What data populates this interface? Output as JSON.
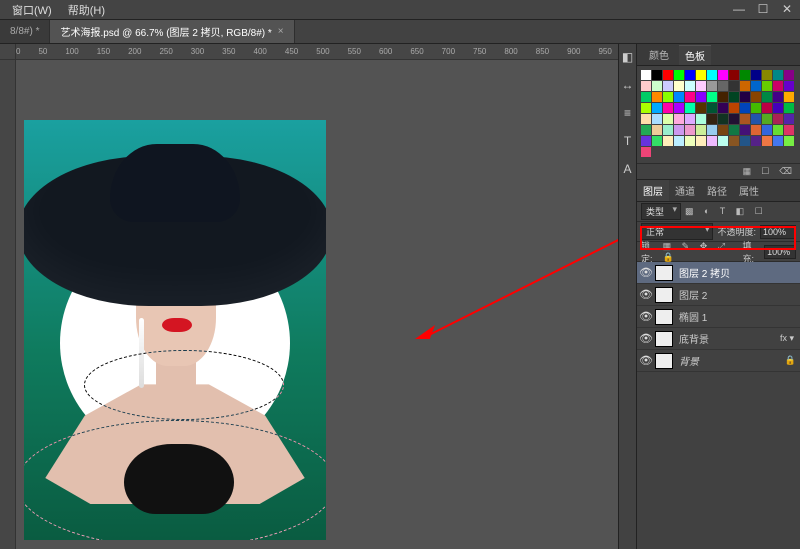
{
  "menu": {
    "window": "窗口(W)",
    "help": "帮助(H)"
  },
  "winctrls": {
    "min": "—",
    "max": "☐",
    "close": "✕"
  },
  "tabs": {
    "inactive": "8/8#) *",
    "active": "艺术海报.psd @ 66.7% (图层 2 拷贝, RGB/8#) *",
    "close": "×"
  },
  "ruler": [
    "0",
    "50",
    "100",
    "150",
    "200",
    "250",
    "300",
    "350",
    "400",
    "450",
    "500",
    "550",
    "600",
    "650",
    "700",
    "750",
    "800",
    "850",
    "900",
    "950"
  ],
  "sidebarIcons": [
    "◧",
    "↔",
    "≡",
    "T",
    "A"
  ],
  "colorTabs": {
    "color": "颜色",
    "swatches": "色板"
  },
  "swatchFooter": {
    "grid": "▦",
    "new": "☐",
    "del": "⌫"
  },
  "layerTabs": {
    "layers": "图层",
    "channels": "通道",
    "paths": "路径",
    "props": "属性"
  },
  "layerOpts": {
    "kind": "类型",
    "blend": "正常",
    "opacityLabel": "不透明度:",
    "opacity": "100%",
    "lockLabel": "锁定:",
    "lockIcons": "▦ ✎ ✥ ⤢ 🔒",
    "fillLabel": "填充:",
    "fill": "100%"
  },
  "layers": [
    {
      "name": "图层 2 拷贝",
      "selected": true,
      "locked": false,
      "fx": false,
      "italic": false
    },
    {
      "name": "图层 2",
      "selected": false,
      "locked": false,
      "fx": false,
      "italic": false
    },
    {
      "name": "椭圆 1",
      "selected": false,
      "locked": false,
      "fx": false,
      "italic": false
    },
    {
      "name": "底背景",
      "selected": false,
      "locked": false,
      "fx": true,
      "italic": false
    },
    {
      "name": "背景",
      "selected": false,
      "locked": true,
      "fx": false,
      "italic": true
    }
  ],
  "glyphs": {
    "eye": "👁",
    "lock": "🔒",
    "fx": "fx ▾"
  }
}
